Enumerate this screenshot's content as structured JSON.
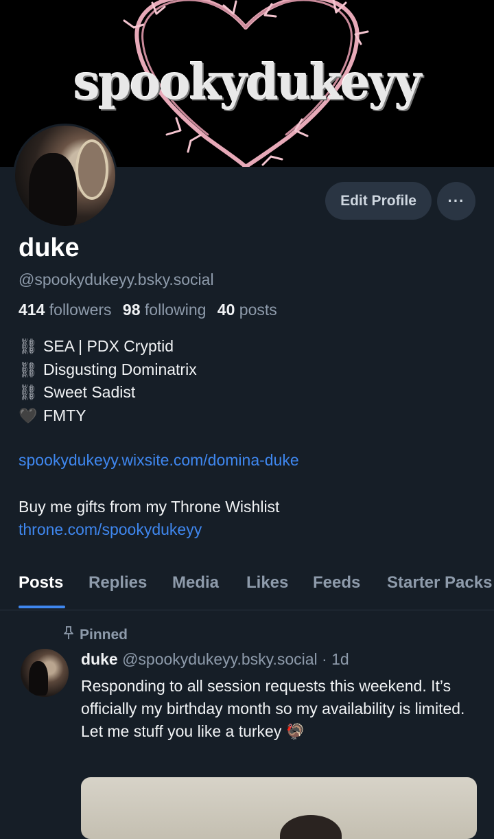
{
  "banner": {
    "title": "spookydukeyy"
  },
  "profile": {
    "display_name": "duke",
    "handle": "@spookydukeyy.bsky.social",
    "followers_count": "414",
    "followers_label": "followers",
    "following_count": "98",
    "following_label": "following",
    "posts_count": "40",
    "posts_label": "posts",
    "edit_button": "Edit Profile",
    "more_button": "···"
  },
  "bio": {
    "lines": [
      {
        "emoji": "⛓",
        "text": "SEA | PDX Cryptid"
      },
      {
        "emoji": "⛓",
        "text": "Disgusting Dominatrix"
      },
      {
        "emoji": "⛓",
        "text": "Sweet Sadist"
      },
      {
        "emoji": "🖤",
        "text": "FMTY"
      }
    ],
    "link1": "spookydukeyy.wixsite.com/domina-duke",
    "wishlist_text": "Buy me gifts from my Throne Wishlist",
    "link2": "throne.com/spookydukeyy"
  },
  "tabs": [
    "Posts",
    "Replies",
    "Media",
    "Likes",
    "Feeds",
    "Starter Packs"
  ],
  "active_tab": "Posts",
  "post": {
    "pinned_label": "Pinned",
    "author": "duke",
    "handle": "@spookydukeyy.bsky.social",
    "separator": "·",
    "time": "1d",
    "text_lines": [
      "Responding to all session requests this weekend. It’s officially my birthday month so my availability is limited.",
      "Let me stuff you like a turkey"
    ],
    "turkey_emoji": "🦃"
  },
  "colors": {
    "background": "#161e27",
    "accent": "#3f87ef",
    "muted_text": "#8e9bab",
    "button_bg": "#2a3543",
    "banner_heart": "#e7a9b8"
  }
}
